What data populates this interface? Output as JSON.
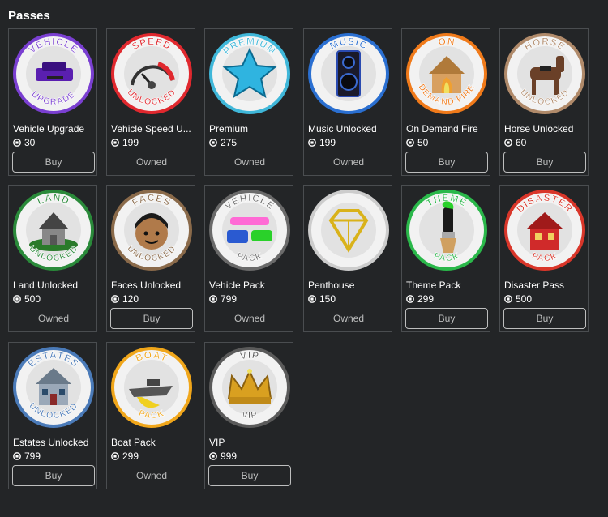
{
  "header": {
    "title": "Passes"
  },
  "colors": {
    "background": "#232527",
    "card_border": "#4a4d50",
    "muted_text": "#bdbebe"
  },
  "currency_icon": "robux-icon",
  "passes": [
    {
      "name": "Vehicle Upgrade",
      "price": "30",
      "status": "Buy",
      "ring": "#7a3fd1",
      "top": "VEHICLE",
      "bottom": "UPGRADE",
      "icon": "car-icon"
    },
    {
      "name": "Vehicle Speed U...",
      "price": "199",
      "status": "Owned",
      "ring": "#e0282e",
      "top": "SPEED",
      "bottom": "UNLOCKED",
      "icon": "speedometer-icon"
    },
    {
      "name": "Premium",
      "price": "275",
      "status": "Owned",
      "ring": "#3fb7d9",
      "top": "PREMIUM",
      "bottom": "",
      "icon": "star-icon"
    },
    {
      "name": "Music Unlocked",
      "price": "199",
      "status": "Owned",
      "ring": "#2a6fd1",
      "top": "MUSIC",
      "bottom": "",
      "icon": "speaker-icon"
    },
    {
      "name": "On Demand Fire",
      "price": "50",
      "status": "Buy",
      "ring": "#f07a1a",
      "top": "ON",
      "bottom": "DEMAND FIRE",
      "icon": "burning-house-icon"
    },
    {
      "name": "Horse Unlocked",
      "price": "60",
      "status": "Buy",
      "ring": "#b08a6a",
      "top": "HORSE",
      "bottom": "UNLOCKED",
      "icon": "horse-icon"
    },
    {
      "name": "Land Unlocked",
      "price": "500",
      "status": "Owned",
      "ring": "#2a8a3a",
      "top": "LAND",
      "bottom": "UNLOCKED",
      "icon": "land-house-icon"
    },
    {
      "name": "Faces Unlocked",
      "price": "120",
      "status": "Buy",
      "ring": "#8a6a4a",
      "top": "FACES",
      "bottom": "UNLOCKED",
      "icon": "face-icon"
    },
    {
      "name": "Vehicle Pack",
      "price": "799",
      "status": "Owned",
      "ring": "#6a6a6a",
      "top": "VEHICLE",
      "bottom": "PACK",
      "icon": "cars-icon"
    },
    {
      "name": "Penthouse",
      "price": "150",
      "status": "Owned",
      "ring": "#cccccc",
      "top": "",
      "bottom": "",
      "icon": "diamond-icon"
    },
    {
      "name": "Theme Pack",
      "price": "299",
      "status": "Buy",
      "ring": "#2ab84a",
      "top": "THEME",
      "bottom": "PACK",
      "icon": "paintbrush-icon"
    },
    {
      "name": "Disaster Pass",
      "price": "500",
      "status": "Buy",
      "ring": "#d9362a",
      "top": "DISASTER",
      "bottom": "PACK",
      "icon": "disaster-house-icon"
    },
    {
      "name": "Estates Unlocked",
      "price": "799",
      "status": "Buy",
      "ring": "#4a7ab8",
      "top": "ESTATES",
      "bottom": "UNLOCKED",
      "icon": "estate-icon"
    },
    {
      "name": "Boat Pack",
      "price": "299",
      "status": "Owned",
      "ring": "#f0a61a",
      "top": "BOAT",
      "bottom": "PACK",
      "icon": "boat-icon"
    },
    {
      "name": "VIP",
      "price": "999",
      "status": "Buy",
      "ring": "#5a5a5a",
      "top": "VIP",
      "bottom": "VIP",
      "icon": "crown-icon"
    }
  ]
}
